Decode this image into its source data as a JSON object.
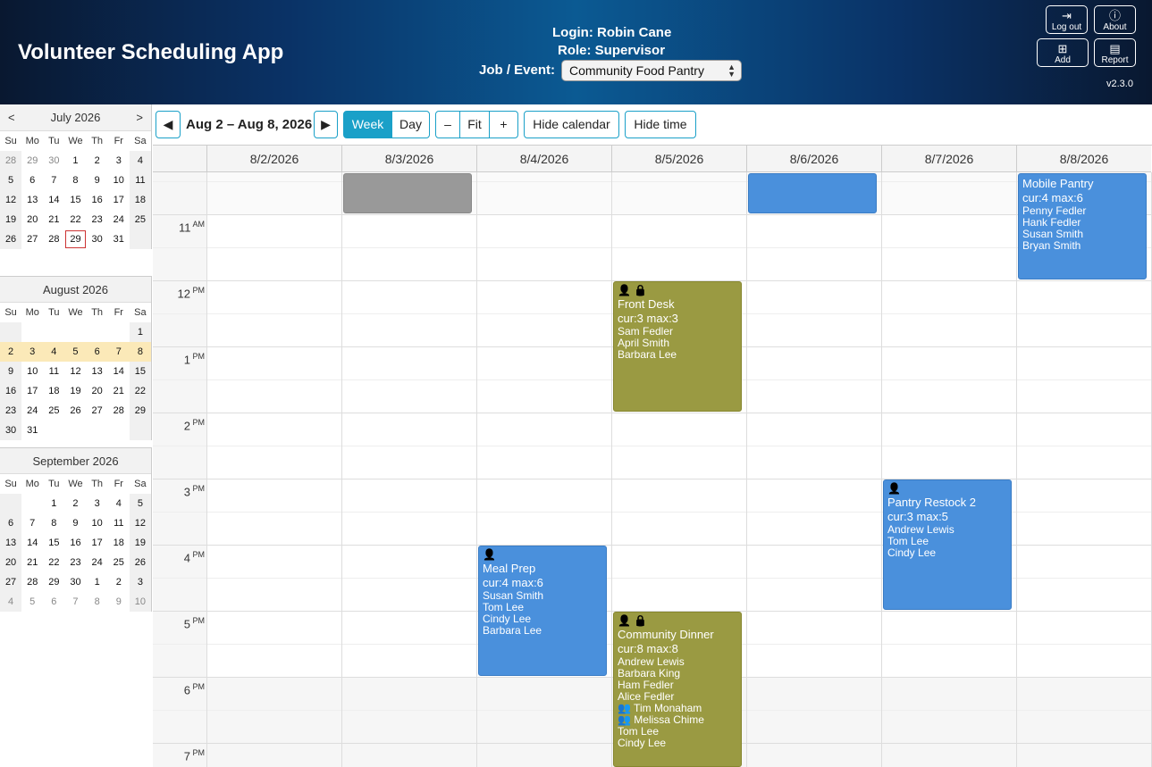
{
  "header": {
    "app_title": "Volunteer Scheduling App",
    "login": "Login: Robin Cane",
    "role": "Role: Supervisor",
    "job_label": "Job / Event:",
    "job_value": "Community Food Pantry",
    "buttons": {
      "logout": "Log out",
      "about": "About",
      "add": "Add",
      "report": "Report"
    },
    "version": "v2.3.0"
  },
  "mini_calendars": [
    {
      "title": "July 2026",
      "prev": "<",
      "next": ">",
      "dow": [
        "Su",
        "Mo",
        "Tu",
        "We",
        "Th",
        "Fr",
        "Sa"
      ],
      "weeks": [
        [
          "28",
          "29",
          "30",
          "1",
          "2",
          "3",
          "4"
        ],
        [
          "5",
          "6",
          "7",
          "8",
          "9",
          "10",
          "11"
        ],
        [
          "12",
          "13",
          "14",
          "15",
          "16",
          "17",
          "18"
        ],
        [
          "19",
          "20",
          "21",
          "22",
          "23",
          "24",
          "25"
        ],
        [
          "26",
          "27",
          "28",
          "29",
          "30",
          "31",
          ""
        ]
      ],
      "today": "29"
    },
    {
      "title": "August 2026",
      "dow": [
        "Su",
        "Mo",
        "Tu",
        "We",
        "Th",
        "Fr",
        "Sa"
      ],
      "weeks": [
        [
          "",
          "",
          "",
          "",
          "",
          "",
          "1"
        ],
        [
          "2",
          "3",
          "4",
          "5",
          "6",
          "7",
          "8"
        ],
        [
          "9",
          "10",
          "11",
          "12",
          "13",
          "14",
          "15"
        ],
        [
          "16",
          "17",
          "18",
          "19",
          "20",
          "21",
          "22"
        ],
        [
          "23",
          "24",
          "25",
          "26",
          "27",
          "28",
          "29"
        ],
        [
          "30",
          "31",
          "",
          "",
          "",
          "",
          ""
        ]
      ],
      "selected_week": 1
    },
    {
      "title": "September 2026",
      "dow": [
        "Su",
        "Mo",
        "Tu",
        "We",
        "Th",
        "Fr",
        "Sa"
      ],
      "weeks": [
        [
          "",
          "",
          "1",
          "2",
          "3",
          "4",
          "5"
        ],
        [
          "6",
          "7",
          "8",
          "9",
          "10",
          "11",
          "12"
        ],
        [
          "13",
          "14",
          "15",
          "16",
          "17",
          "18",
          "19"
        ],
        [
          "20",
          "21",
          "22",
          "23",
          "24",
          "25",
          "26"
        ],
        [
          "27",
          "28",
          "29",
          "30",
          "1",
          "2",
          "3"
        ],
        [
          "4",
          "5",
          "6",
          "7",
          "8",
          "9",
          "10"
        ]
      ]
    }
  ],
  "toolbar": {
    "prev": "◀",
    "next": "▶",
    "range": "Aug 2 – Aug 8, 2026",
    "week": "Week",
    "day": "Day",
    "zoom_out": "–",
    "fit": "Fit",
    "zoom_in": "+",
    "hide_calendar": "Hide calendar",
    "hide_time": "Hide time"
  },
  "week": {
    "days": [
      "8/2/2026",
      "8/3/2026",
      "8/4/2026",
      "8/5/2026",
      "8/6/2026",
      "8/7/2026",
      "8/8/2026"
    ],
    "hours": [
      {
        "h": "11",
        "ap": "AM"
      },
      {
        "h": "12",
        "ap": "PM"
      },
      {
        "h": "1",
        "ap": "PM"
      },
      {
        "h": "2",
        "ap": "PM"
      },
      {
        "h": "3",
        "ap": "PM"
      },
      {
        "h": "4",
        "ap": "PM"
      },
      {
        "h": "5",
        "ap": "PM"
      },
      {
        "h": "6",
        "ap": "PM"
      },
      {
        "h": "7",
        "ap": "PM"
      }
    ]
  },
  "events": [
    {
      "day": 1,
      "start": 10.0,
      "end": 11.0,
      "color": "gray",
      "title": "",
      "cap": "",
      "people": [],
      "locked": false,
      "person_icon": false
    },
    {
      "day": 4,
      "start": 10.0,
      "end": 11.0,
      "color": "blue",
      "title": "",
      "cap": "",
      "people": [],
      "locked": false,
      "person_icon": false
    },
    {
      "day": 6,
      "start": 10.35,
      "end": 12.0,
      "color": "blue",
      "title": "Mobile Pantry",
      "cap": "cur:4 max:6",
      "people": [
        "Penny Fedler",
        "Hank Fedler",
        "Susan Smith",
        "Bryan Smith"
      ],
      "locked": false,
      "person_icon": false
    },
    {
      "day": 3,
      "start": 12.0,
      "end": 14.0,
      "color": "olive",
      "title": "Front Desk",
      "cap": "cur:3 max:3",
      "people": [
        "Sam Fedler",
        "April Smith",
        "Barbara Lee"
      ],
      "locked": true,
      "person_icon": true
    },
    {
      "day": 5,
      "start": 15.0,
      "end": 17.0,
      "color": "blue",
      "title": "Pantry Restock 2",
      "cap": "cur:3 max:5",
      "people": [
        "Andrew Lewis",
        "Tom Lee",
        "Cindy Lee"
      ],
      "locked": false,
      "person_icon": true
    },
    {
      "day": 2,
      "start": 16.0,
      "end": 18.0,
      "color": "blue",
      "title": "Meal Prep",
      "cap": "cur:4 max:6",
      "people": [
        "Susan Smith",
        "Tom Lee",
        "Cindy Lee",
        "Barbara Lee"
      ],
      "locked": false,
      "person_icon": true
    },
    {
      "day": 3,
      "start": 17.0,
      "end": 19.5,
      "color": "olive",
      "title": "Community Dinner",
      "cap": "cur:8 max:8",
      "people": [
        "Andrew Lewis",
        "Barbara King",
        "Ham Fedler",
        "Alice Fedler",
        "👥 Tim Monaham",
        "👥 Melissa Chime",
        "Tom Lee",
        "Cindy Lee"
      ],
      "locked": true,
      "person_icon": true
    }
  ]
}
